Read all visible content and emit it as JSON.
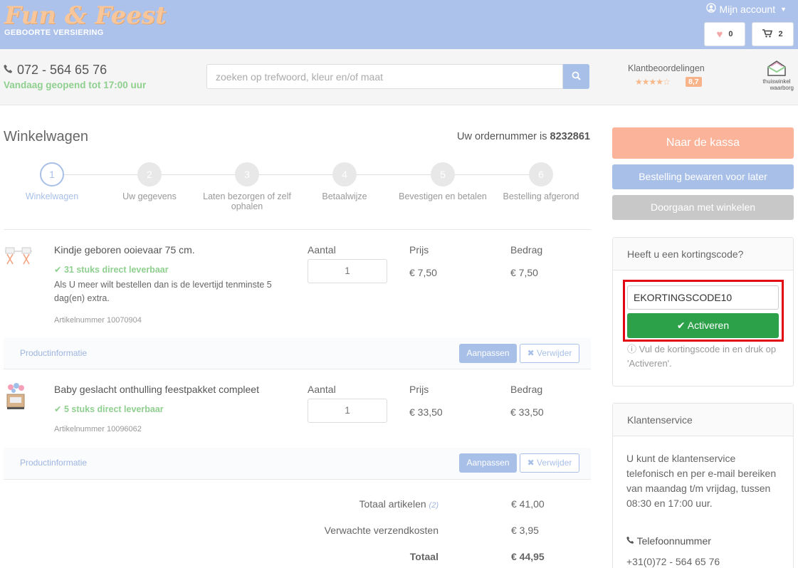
{
  "header": {
    "logo_text": "Fun & Feest",
    "logo_subtitle": "GEBOORTE VERSIERING",
    "account_label": "Mijn account",
    "wishlist_count": "0",
    "cart_count": "2"
  },
  "subheader": {
    "phone": "072 - 564 65 76",
    "open_status": "Vandaag geopend tot 17:00 uur",
    "search_placeholder": "zoeken op trefwoord, kleur en/of maat",
    "reviews_label": "Klantbeoordelingen",
    "review_score": "8,7",
    "review_stars": 4.5,
    "badge_line1": "thuiswinkel",
    "badge_line2": "waarborg"
  },
  "cart": {
    "title": "Winkelwagen",
    "order_prefix": "Uw ordernummer is",
    "order_number": "8232861",
    "steps": [
      {
        "num": "1",
        "label": "Winkelwagen"
      },
      {
        "num": "2",
        "label": "Uw gegevens"
      },
      {
        "num": "3",
        "label": "Laten bezorgen of zelf ophalen"
      },
      {
        "num": "4",
        "label": "Betaalwijze"
      },
      {
        "num": "5",
        "label": "Bevestigen en betalen"
      },
      {
        "num": "6",
        "label": "Bestelling afgerond"
      }
    ],
    "col_qty": "Aantal",
    "col_price": "Prijs",
    "col_amount": "Bedrag",
    "items": [
      {
        "name": "Kindje geboren ooievaar 75 cm.",
        "stock": "31 stuks direct leverbaar",
        "note": "Als U meer wilt bestellen dan is de levertijd tenminste 5 dag(en) extra.",
        "article": "Artikelnummer 10070904",
        "qty": "1",
        "price": "€ 7,50",
        "amount": "€ 7,50"
      },
      {
        "name": "Baby geslacht onthulling feestpakket compleet",
        "stock": "5 stuks direct leverbaar",
        "article": "Artikelnummer 10096062",
        "qty": "1",
        "price": "€ 33,50",
        "amount": "€ 33,50"
      }
    ],
    "product_info_label": "Productinformatie",
    "adjust_label": "Aanpassen",
    "remove_label": "Verwijder",
    "total_items_label": "Totaal artikelen",
    "total_items_count": "(2)",
    "total_items_value": "€ 41,00",
    "shipping_label": "Verwachte verzendkosten",
    "shipping_value": "€ 3,95",
    "total_label": "Totaal",
    "total_value": "€ 44,95"
  },
  "sidebar": {
    "checkout_label": "Naar de kassa",
    "save_label": "Bestelling bewaren voor later",
    "continue_label": "Doorgaan met winkelen",
    "discount_title": "Heeft u een kortingscode?",
    "discount_value": "EKORTINGSCODE10",
    "activate_label": "Activeren",
    "discount_help": "Vul de kortingscode in en druk op 'Activeren'.",
    "service_title": "Klantenservice",
    "service_text": "U kunt de klantenservice telefonisch en per e-mail bereiken van maandag t/m vrijdag, tussen 08:30 en 17:00 uur.",
    "phone_heading": "Telefoonnummer",
    "phone_number": "+31(0)72 - 564 65 76"
  },
  "colors": {
    "header_bg": "#adc2ea",
    "accent_blue": "#a8bfe8",
    "checkout_orange": "#fbb49a",
    "success_green": "#2ca14a",
    "stock_green": "#8fcf8f",
    "highlight_red": "#e20613"
  }
}
